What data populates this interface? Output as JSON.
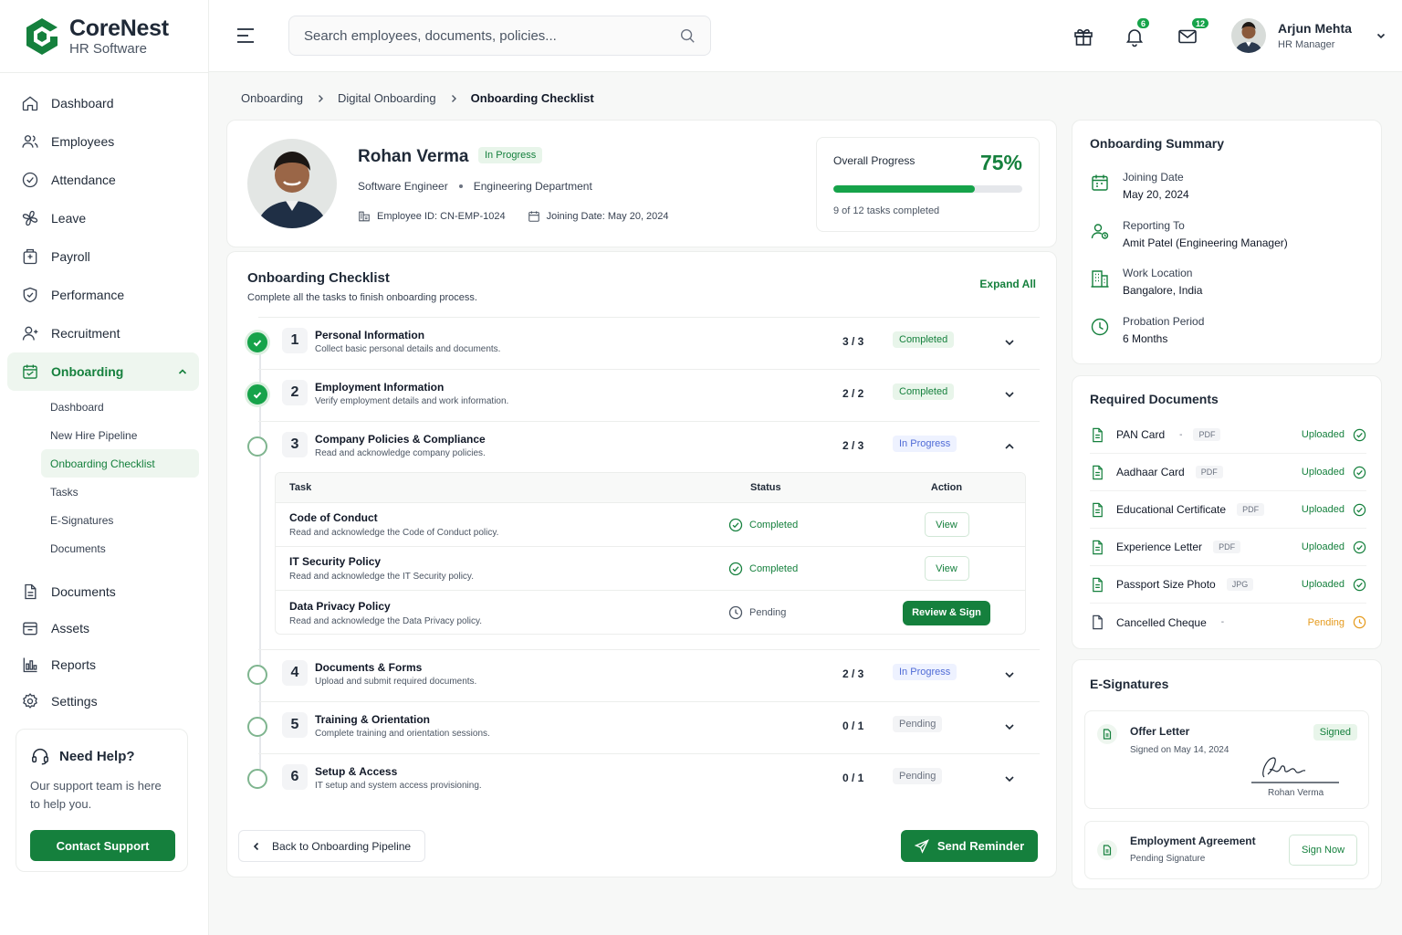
{
  "brand": {
    "name": "CoreNest",
    "subtitle": "HR Software",
    "color": "#15803d"
  },
  "topbar": {
    "search_placeholder": "Search employees, documents, policies...",
    "notifications_count": "6",
    "messages_count": "12",
    "user": {
      "name": "Arjun Mehta",
      "role": "HR Manager"
    }
  },
  "sidebar": {
    "items": [
      {
        "label": "Dashboard",
        "icon": "home-icon"
      },
      {
        "label": "Employees",
        "icon": "users-icon"
      },
      {
        "label": "Attendance",
        "icon": "check-circle-icon"
      },
      {
        "label": "Leave",
        "icon": "leave-icon"
      },
      {
        "label": "Payroll",
        "icon": "wallet-icon"
      },
      {
        "label": "Performance",
        "icon": "shield-icon"
      },
      {
        "label": "Recruitment",
        "icon": "recruit-icon"
      },
      {
        "label": "Onboarding",
        "icon": "calendar-icon"
      }
    ],
    "onboarding_sub": [
      "Dashboard",
      "New Hire Pipeline",
      "Onboarding Checklist",
      "Tasks",
      "E-Signatures",
      "Documents"
    ],
    "items_bottom": [
      {
        "label": "Documents",
        "icon": "document-icon"
      },
      {
        "label": "Assets",
        "icon": "assets-icon"
      },
      {
        "label": "Reports",
        "icon": "reports-icon"
      },
      {
        "label": "Settings",
        "icon": "gear-icon"
      }
    ],
    "help": {
      "title": "Need Help?",
      "text": "Our support team is here to help you.",
      "button": "Contact Support"
    }
  },
  "breadcrumb": [
    "Onboarding",
    "Digital Onboarding",
    "Onboarding Checklist"
  ],
  "employee": {
    "name": "Rohan Verma",
    "status": "In Progress",
    "title": "Software Engineer",
    "department": "Engineering Department",
    "employee_id": "Employee ID: CN-EMP-1024",
    "joining": "Joining Date: May 20, 2024"
  },
  "progress": {
    "label": "Overall Progress",
    "percent_text": "75%",
    "percent": 75,
    "footer": "9 of 12 tasks completed"
  },
  "checklist": {
    "title": "Onboarding Checklist",
    "subtitle": "Complete all the tasks to finish onboarding process.",
    "expand_all": "Expand All",
    "steps": [
      {
        "num": "1",
        "title": "Personal Information",
        "desc": "Collect basic personal details and documents.",
        "count": "3 / 3",
        "status": "Completed"
      },
      {
        "num": "2",
        "title": "Employment Information",
        "desc": "Verify employment details and work information.",
        "count": "2 / 2",
        "status": "Completed"
      },
      {
        "num": "3",
        "title": "Company Policies & Compliance",
        "desc": "Read and acknowledge company policies.",
        "count": "2 / 3",
        "status": "In Progress"
      },
      {
        "num": "4",
        "title": "Documents & Forms",
        "desc": "Upload and submit required documents.",
        "count": "2 / 3",
        "status": "In Progress"
      },
      {
        "num": "5",
        "title": "Training & Orientation",
        "desc": "Complete training and orientation sessions.",
        "count": "0 / 1",
        "status": "Pending"
      },
      {
        "num": "6",
        "title": "Setup & Access",
        "desc": "IT setup and system access provisioning.",
        "count": "0 / 1",
        "status": "Pending"
      }
    ],
    "task_headers": {
      "task": "Task",
      "status": "Status",
      "action": "Action"
    },
    "tasks": [
      {
        "name": "Code of Conduct",
        "desc": "Read and acknowledge the Code of Conduct policy.",
        "status": "Completed",
        "action": "View"
      },
      {
        "name": "IT Security Policy",
        "desc": "Read and acknowledge the IT Security policy.",
        "status": "Completed",
        "action": "View"
      },
      {
        "name": "Data Privacy Policy",
        "desc": "Read and acknowledge the Data Privacy policy.",
        "status": "Pending",
        "action": "Review & Sign"
      }
    ],
    "back_button": "Back to Onboarding Pipeline",
    "reminder_button": "Send Reminder"
  },
  "summary": {
    "title": "Onboarding Summary",
    "items": [
      {
        "label": "Joining Date",
        "value": "May 20, 2024"
      },
      {
        "label": "Reporting To",
        "value": "Amit Patel (Engineering Manager)"
      },
      {
        "label": "Work Location",
        "value": "Bangalore, India"
      },
      {
        "label": "Probation Period",
        "value": "6 Months"
      }
    ]
  },
  "documents": {
    "title": "Required Documents",
    "items": [
      {
        "name": "PAN Card",
        "type": "PDF",
        "status": "Uploaded"
      },
      {
        "name": "Aadhaar Card",
        "type": "PDF",
        "status": "Uploaded"
      },
      {
        "name": "Educational Certificate",
        "type": "PDF",
        "status": "Uploaded"
      },
      {
        "name": "Experience Letter",
        "type": "PDF",
        "status": "Uploaded"
      },
      {
        "name": "Passport Size Photo",
        "type": "JPG",
        "status": "Uploaded"
      },
      {
        "name": "Cancelled Cheque",
        "type": "-",
        "status": "Pending"
      }
    ]
  },
  "esignatures": {
    "title": "E-Signatures",
    "offer": {
      "name": "Offer Letter",
      "status": "Signed",
      "date": "Signed on May 14, 2024",
      "signer": "Rohan Verma"
    },
    "agreement": {
      "name": "Employment Agreement",
      "status": "Pending Signature",
      "button": "Sign Now"
    }
  }
}
